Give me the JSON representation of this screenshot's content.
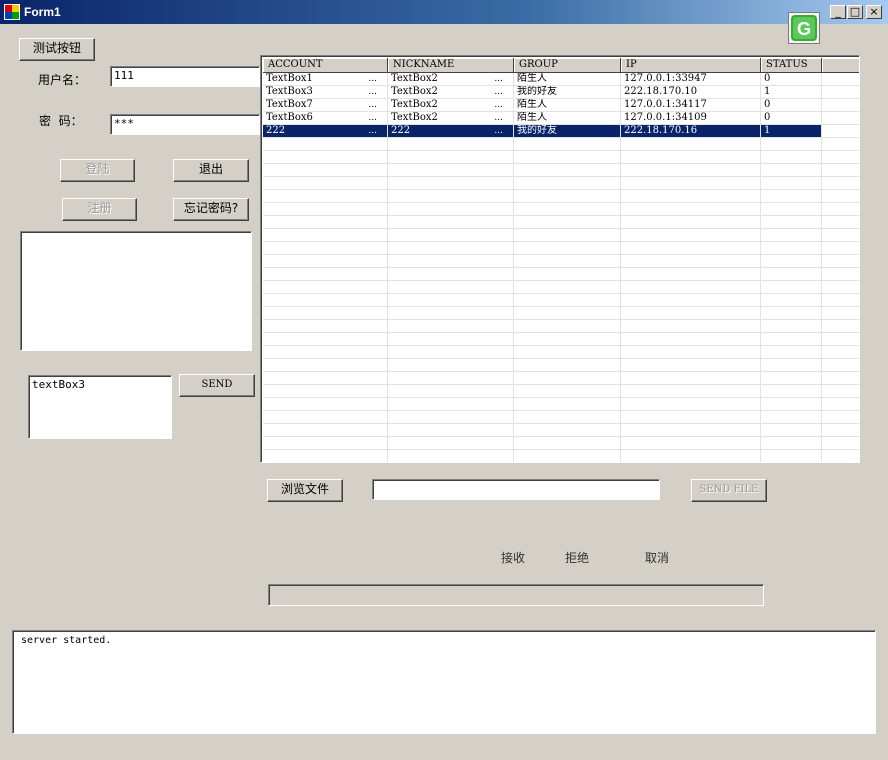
{
  "window": {
    "title": "Form1",
    "minimize": "_",
    "maximize": "□",
    "close": "×"
  },
  "brand_icon_letter": "G",
  "left_panel": {
    "test_button": "测试按钮",
    "username_label": "用户名：",
    "username_value": "111",
    "password_label": "密  码：",
    "password_value": "***",
    "login_button": "登陆",
    "exit_button": "退出",
    "register_button": "注册",
    "forgot_button": "忘记密码?",
    "message_box_value": "textBox3",
    "send_button": "SEND"
  },
  "grid": {
    "columns": [
      "ACCOUNT",
      "NICKNAME",
      "GROUP",
      "IP",
      "STATUS"
    ],
    "ellipsis": "...",
    "rows": [
      {
        "account": "TextBox1",
        "nickname": "TextBox2",
        "group": "陌生人",
        "ip": "127.0.0.1:33947",
        "status": "0"
      },
      {
        "account": "TextBox3",
        "nickname": "TextBox2",
        "group": "我的好友",
        "ip": "222.18.170.10",
        "status": "1"
      },
      {
        "account": "TextBox7",
        "nickname": "TextBox2",
        "group": "陌生人",
        "ip": "127.0.0.1:34117",
        "status": "0"
      },
      {
        "account": "TextBox6",
        "nickname": "TextBox2",
        "group": "陌生人",
        "ip": "127.0.0.1:34109",
        "status": "0"
      },
      {
        "account": "222",
        "nickname": "222",
        "group": "我的好友",
        "ip": "222.18.170.16",
        "status": "1"
      }
    ],
    "selected_row": 4
  },
  "file_area": {
    "browse_button": "浏览文件",
    "file_path_value": "",
    "send_file_button": "SEND FILE",
    "accept_label": "接收",
    "reject_label": "拒绝",
    "cancel_label": "取消"
  },
  "log": {
    "text": "server started."
  },
  "colors": {
    "face": "#d4d0c8",
    "selection": "#0a246a",
    "title_start": "#0a246a"
  }
}
